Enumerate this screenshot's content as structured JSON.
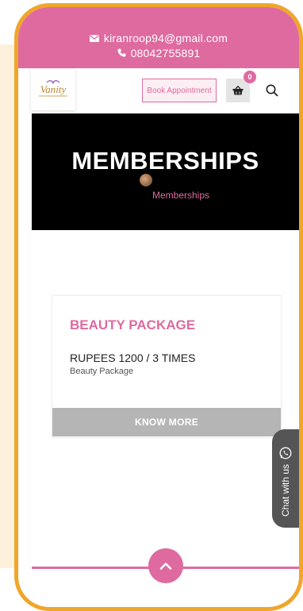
{
  "topbar": {
    "email": "kiranroop94@gmail.com",
    "phone": "08042755891",
    "email_icon": "mail-icon",
    "phone_icon": "phone-icon"
  },
  "header": {
    "logo_text": "Vanity",
    "book_label": "Book Appointment",
    "cart_count": "0",
    "cart_icon": "basket-icon",
    "search_icon": "search-icon"
  },
  "hero": {
    "title": "MEMBERSHIPS",
    "breadcrumb": "Memberships"
  },
  "card": {
    "title": "BEAUTY PACKAGE",
    "price": "RUPEES 1200 / 3 TIMES",
    "subtitle": "Beauty Package",
    "button": "KNOW MORE"
  },
  "chat": {
    "label": "Chat with us",
    "icon": "whatsapp-icon"
  },
  "scroll_top_icon": "chevron-up-icon",
  "colors": {
    "accent": "#de6aa0",
    "frame": "#f0a62a",
    "hero_bg": "#000000"
  }
}
